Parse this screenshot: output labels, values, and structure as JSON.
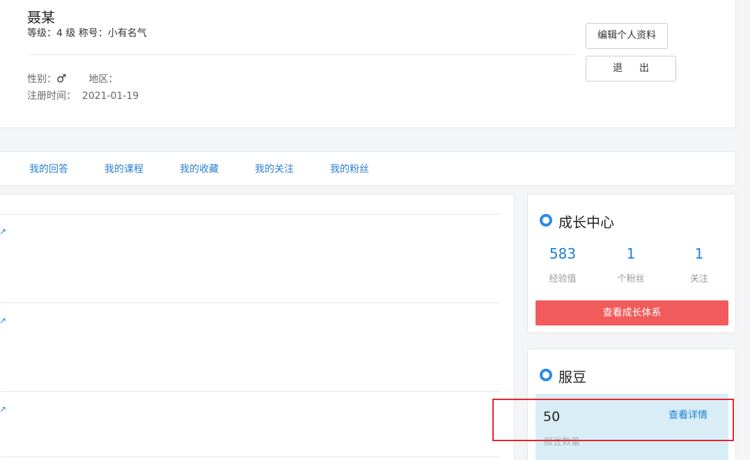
{
  "profile": {
    "name": "聂某",
    "level_text": "等级：4 级 称号：小有名气",
    "gender_label": "性别：",
    "gender_symbol": "♂",
    "region_label": "地区：",
    "region_value": "",
    "register_label": "注册时间：",
    "register_date": "2021-01-19",
    "edit_button": "编辑个人资料",
    "logout_button": "退出"
  },
  "tabs": [
    "我的回答",
    "我的课程",
    "我的收藏",
    "我的关注",
    "我的粉丝"
  ],
  "growth": {
    "title": "成长中心",
    "stats": [
      {
        "value": "583",
        "label": "经验值"
      },
      {
        "value": "1",
        "label": "个粉丝"
      },
      {
        "value": "1",
        "label": "关注"
      }
    ],
    "button": "查看成长体系"
  },
  "fudou": {
    "title": "服豆",
    "value": "50",
    "label": "服豆数量",
    "link": "查看详情"
  },
  "colors": {
    "accent": "#2a8be6",
    "link": "#2b7fd4",
    "danger_button": "#f25b5b",
    "fudou_bg": "#d9edf7",
    "highlight": "#e3242b"
  }
}
